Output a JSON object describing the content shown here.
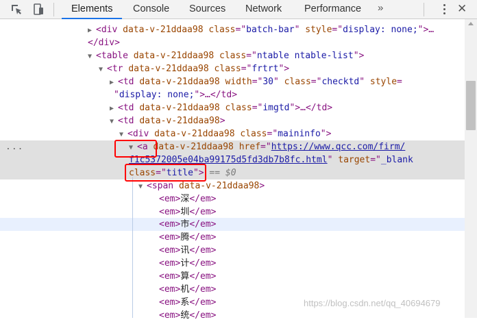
{
  "toolbar": {
    "tabs": [
      {
        "label": "Elements",
        "active": true
      },
      {
        "label": "Console"
      },
      {
        "label": "Sources"
      },
      {
        "label": "Network"
      },
      {
        "label": "Performance"
      }
    ],
    "more_tabs": "»",
    "close": "✕"
  },
  "tree": {
    "r1": {
      "t1": "<div ",
      "a1": "data-v-21ddaa98 ",
      "a2": "class",
      "t2": "=\"",
      "v2": "batch-bar",
      "t3": "\" ",
      "a3": "style",
      "t4": "=\"",
      "v4": "display: none;",
      "t5": "\">…"
    },
    "r2": {
      "t1": "</div>"
    },
    "r3": {
      "t1": "<table ",
      "a1": "data-v-21ddaa98 ",
      "a2": "class",
      "t2": "=\"",
      "v2": "ntable ntable-list",
      "t3": "\">"
    },
    "r4": {
      "t1": "<tr ",
      "a1": "data-v-21ddaa98 ",
      "a2": "class",
      "t2": "=\"",
      "v2": "frtrt",
      "t3": "\">"
    },
    "r5": {
      "t1": "<td ",
      "a1": "data-v-21ddaa98 ",
      "a2": "width",
      "t2": "=\"",
      "v2": "30",
      "t3": "\" ",
      "a3": "class",
      "t4": "=\"",
      "v4": "checktd",
      "t5": "\" ",
      "a5": "style",
      "t6": "="
    },
    "r6": {
      "t1": "\"",
      "v1": "display: none;",
      "t2": "\">…</td>"
    },
    "r7": {
      "t1": "<td ",
      "a1": "data-v-21ddaa98 ",
      "a2": "class",
      "t2": "=\"",
      "v2": "imgtd",
      "t3": "\">…</td>"
    },
    "r8": {
      "t1": "<td ",
      "a1": "data-v-21ddaa98",
      "t2": ">"
    },
    "r9": {
      "t1": "<div ",
      "a1": "data-v-21ddaa98 ",
      "a2": "class",
      "t2": "=\"",
      "v2": "maininfo",
      "t3": "\">"
    },
    "r10": {
      "dots": "...",
      "t1": "<a ",
      "a1": "data-v-21ddaa98 ",
      "a2": "href",
      "t2": "=\"",
      "v2": "https://www.qcc.com/firm/"
    },
    "r11": {
      "v1": "f1c5372005e04ba99175d5fd3db7b8fc.html",
      "t1": "\" ",
      "a1": "target",
      "t2": "=\"",
      "v2": "_blank"
    },
    "r12": {
      "a1": "class",
      "t1": "=\"",
      "v1": "title",
      "t2": "\"> ",
      "eq": "== $0"
    },
    "r13": {
      "t1": "<span ",
      "a1": "data-v-21ddaa98",
      "t2": ">"
    },
    "ems": [
      "深",
      "圳",
      "市",
      "腾",
      "讯",
      "计",
      "算",
      "机",
      "系",
      "统"
    ],
    "em_open": "<em>",
    "em_close": "</em>"
  },
  "watermark": "https://blog.csdn.net/qq_40694679"
}
